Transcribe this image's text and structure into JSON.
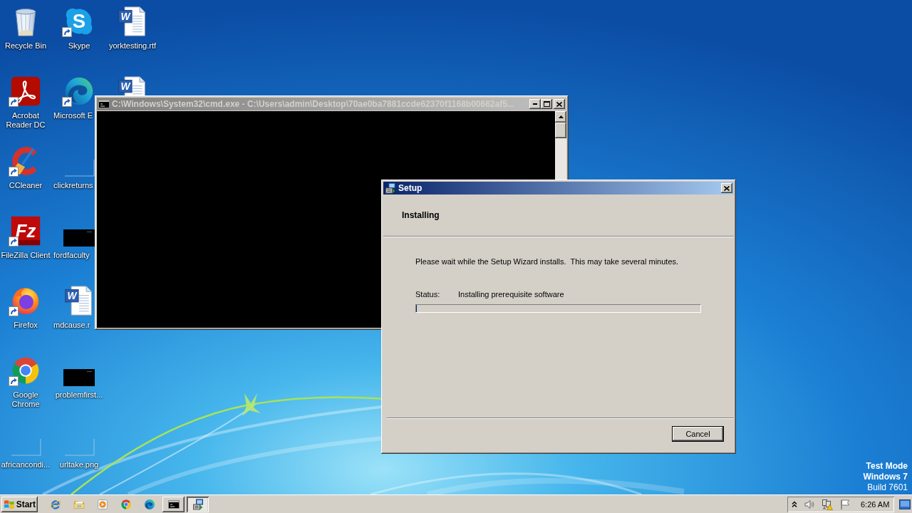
{
  "desktop": {
    "icon_columns": [
      [
        {
          "label": "Recycle Bin",
          "kind": "recycle-bin",
          "shortcut": false
        },
        {
          "label": "Acrobat Reader DC",
          "kind": "acrobat",
          "shortcut": true
        },
        {
          "label": "CCleaner",
          "kind": "ccleaner",
          "shortcut": true
        },
        {
          "label": "FileZilla Client",
          "kind": "filezilla",
          "shortcut": true,
          "logo_text": "Fz"
        },
        {
          "label": "Firefox",
          "kind": "firefox",
          "shortcut": true
        },
        {
          "label": "Google Chrome",
          "kind": "chrome",
          "shortcut": true
        },
        {
          "label": "africancondi...",
          "kind": "blank-thumbnail",
          "shortcut": false
        }
      ],
      [
        {
          "label": "Skype",
          "kind": "skype",
          "shortcut": true,
          "logo_text": "S"
        },
        {
          "label": "Microsoft E",
          "kind": "edge",
          "shortcut": true
        },
        {
          "label": "clickreturns",
          "kind": "blank-thumbnail",
          "shortcut": false
        },
        {
          "label": "fordfaculty",
          "kind": "dark-thumbnail",
          "shortcut": false
        },
        {
          "label": "mdcause.r",
          "kind": "word-doc",
          "shortcut": false,
          "logo_text": "W"
        },
        {
          "label": "problemfirst...",
          "kind": "dark-thumbnail",
          "shortcut": false
        },
        {
          "label": "urltake.png",
          "kind": "blank-thumbnail",
          "shortcut": false
        }
      ],
      [
        {
          "label": "yorktesting.rtf",
          "kind": "word-doc",
          "shortcut": false,
          "logo_text": "W"
        },
        {
          "kind": "word-doc",
          "shortcut": false,
          "logo_text": "W"
        }
      ]
    ],
    "notice": [
      {
        "text": "Test Mode",
        "bold": true
      },
      {
        "text": "Windows 7",
        "bold": true
      },
      {
        "text": "Build 7601",
        "bold": false
      }
    ]
  },
  "console_window": {
    "title": "C:\\Windows\\System32\\cmd.exe - C:\\Users\\admin\\Desktop\\70ae0ba7881ccde62370f1168b00662af5...",
    "active": false
  },
  "setup_dialog": {
    "title": "Setup",
    "active": true,
    "heading": "Installing",
    "message": "Please wait while the Setup Wizard installs.  This may take several minutes.",
    "status_label": "Status:",
    "status_text": "Installing prerequisite software",
    "progress": {
      "level": 0
    },
    "buttons": [
      {
        "label": "Cancel",
        "default": true
      }
    ]
  },
  "taskbar": {
    "start_label": "Start",
    "tasks": [
      {
        "kind": "console",
        "selected": false
      },
      {
        "kind": "installer",
        "selected": true
      }
    ],
    "clock": "6:26 AM"
  }
}
